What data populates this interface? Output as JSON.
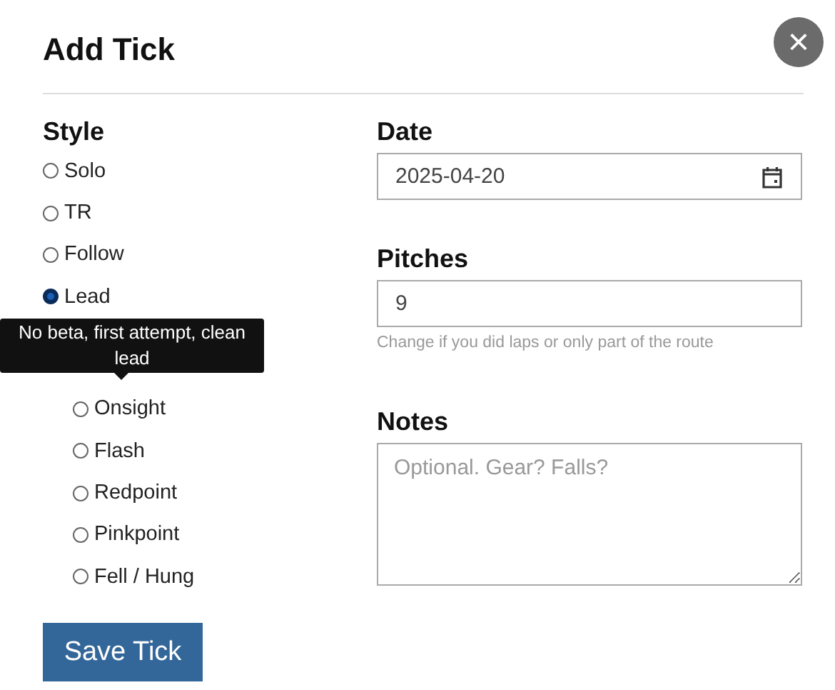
{
  "dialog": {
    "title": "Add Tick",
    "close": "×"
  },
  "style": {
    "label": "Style",
    "options": [
      {
        "label": "Solo",
        "selected": false
      },
      {
        "label": "TR",
        "selected": false
      },
      {
        "label": "Follow",
        "selected": false
      },
      {
        "label": "Lead",
        "selected": true,
        "children": [
          {
            "label": "Onsight",
            "selected": false
          },
          {
            "label": "Flash",
            "selected": false
          },
          {
            "label": "Redpoint",
            "selected": false
          },
          {
            "label": "Pinkpoint",
            "selected": false
          },
          {
            "label": "Fell / Hung",
            "selected": false
          }
        ]
      }
    ]
  },
  "tooltip": {
    "text": "No beta, first attempt, clean lead"
  },
  "date": {
    "label": "Date",
    "value": "2025-04-20"
  },
  "pitches": {
    "label": "Pitches",
    "value": "9",
    "help": "Change if you did laps or only part of the route"
  },
  "notes": {
    "label": "Notes",
    "placeholder": "Optional. Gear? Falls?"
  },
  "save_button": "Save Tick"
}
